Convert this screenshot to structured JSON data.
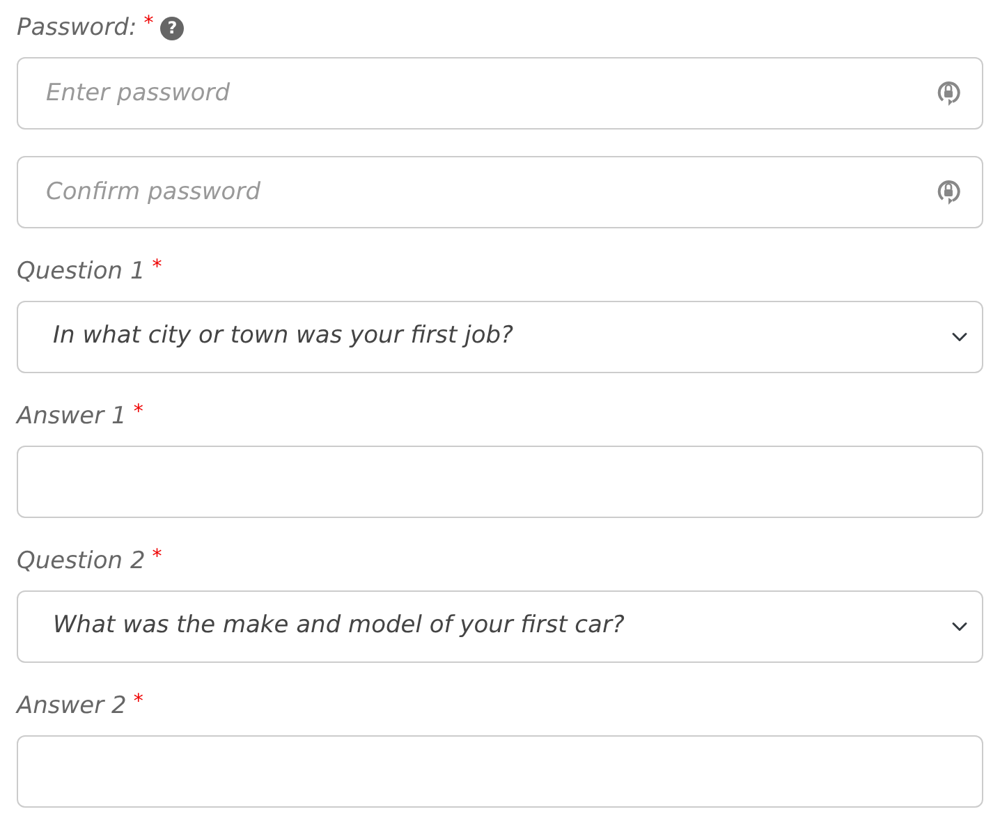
{
  "fields": [
    {
      "kind": "password",
      "label": "Password:",
      "required_mark": "*",
      "help": "?",
      "inputs": [
        {
          "placeholder": "Enter password"
        },
        {
          "placeholder": "Confirm password"
        }
      ]
    },
    {
      "kind": "select",
      "label": "Question 1",
      "required_mark": "*",
      "value": "In what city or town was your first job?"
    },
    {
      "kind": "text",
      "label": "Answer 1",
      "required_mark": "*"
    },
    {
      "kind": "select",
      "label": "Question 2",
      "required_mark": "*",
      "value": "What was the make and model of your first car?"
    },
    {
      "kind": "text",
      "label": "Answer 2",
      "required_mark": "*"
    }
  ]
}
